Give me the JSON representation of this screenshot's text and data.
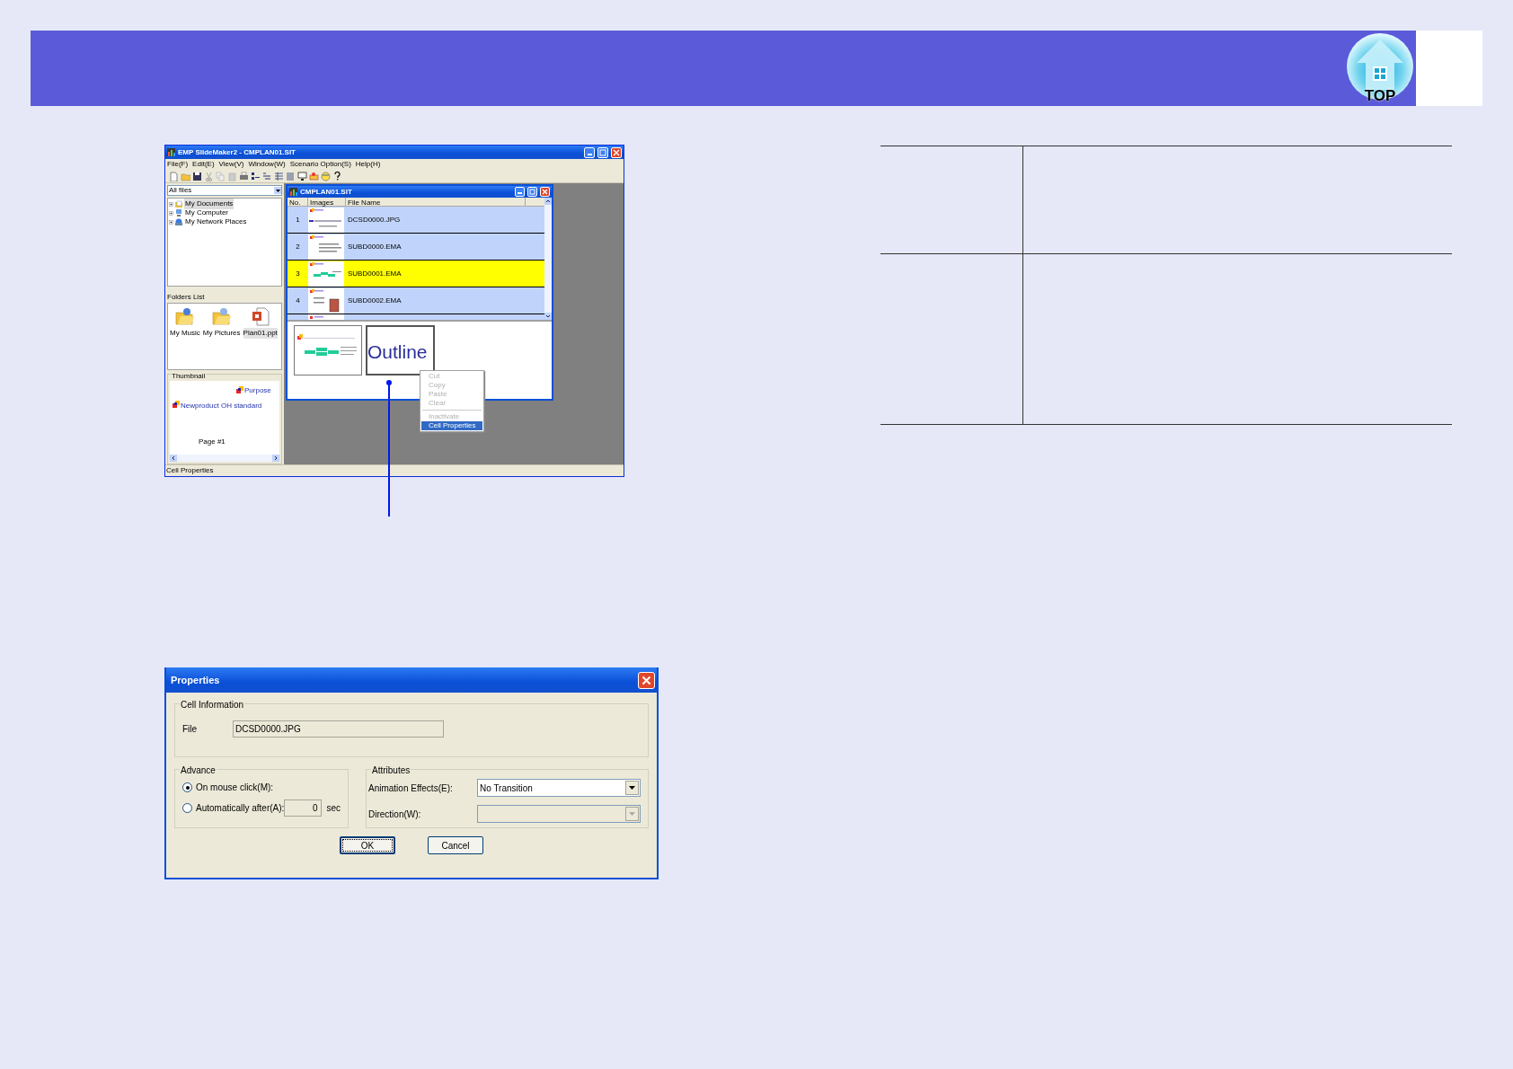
{
  "header": {
    "top_button": {
      "label": "TOP"
    }
  },
  "app_window": {
    "title": "EMP SlideMaker2 - CMPLAN01.SIT",
    "menus": [
      "File(F)",
      "Edit(E)",
      "View(V)",
      "Window(W)",
      "Scenario Option(S)",
      "Help(H)"
    ],
    "file_filter": "All files",
    "tree": [
      {
        "label": "My Documents",
        "selected": true
      },
      {
        "label": "My Computer",
        "selected": false
      },
      {
        "label": "My Network Places",
        "selected": false
      }
    ],
    "folders_list": {
      "title": "Folders List",
      "items": [
        {
          "label": "My Music",
          "kind": "folder",
          "selected": false
        },
        {
          "label": "My Pictures",
          "kind": "folder",
          "selected": false
        },
        {
          "label": "Plan01.ppt",
          "kind": "document",
          "selected": true
        }
      ]
    },
    "thumbnail": {
      "title": "Thumbnail",
      "slide_title": "Newproduct OH standard",
      "side_title": "Purpose",
      "page": "Page #1"
    },
    "document": {
      "title": "CMPLAN01.SIT",
      "columns": [
        "No.",
        "Images",
        "File Name"
      ],
      "rows": [
        {
          "no": "1",
          "file_name": "DCSD0000.JPG",
          "selected": false
        },
        {
          "no": "2",
          "file_name": "SUBD0000.EMA",
          "selected": false
        },
        {
          "no": "3",
          "file_name": "SUBD0001.EMA",
          "selected": true
        },
        {
          "no": "4",
          "file_name": "SUBD0002.EMA",
          "selected": false
        }
      ],
      "preview_text": "Outline"
    },
    "context_menu": [
      {
        "label": "Cut",
        "disabled": true,
        "selected": false
      },
      {
        "label": "Copy",
        "disabled": true,
        "selected": false
      },
      {
        "label": "Paste",
        "disabled": true,
        "selected": false
      },
      {
        "label": "Clear",
        "disabled": true,
        "selected": false
      },
      {
        "label": "Inactivate",
        "disabled": true,
        "selected": false
      },
      {
        "label": "Cell Properties",
        "disabled": false,
        "selected": true
      }
    ],
    "status_bar": "Cell Properties"
  },
  "properties_dialog": {
    "title": "Properties",
    "cell_information": {
      "title": "Cell Information",
      "file_label": "File",
      "file_value": "DCSD0000.JPG"
    },
    "advance": {
      "title": "Advance",
      "options": [
        {
          "label": "On mouse click(M):",
          "selected": true
        },
        {
          "label": "Automatically after(A):",
          "selected": false
        }
      ],
      "seconds": "0",
      "unit": "sec"
    },
    "attributes": {
      "title": "Attributes",
      "animation_label": "Animation Effects(E):",
      "animation_value": "No Transition",
      "direction_label": "Direction(W):",
      "direction_disabled": true
    },
    "buttons": [
      {
        "label": "OK",
        "default": true
      },
      {
        "label": "Cancel",
        "default": false
      }
    ]
  }
}
